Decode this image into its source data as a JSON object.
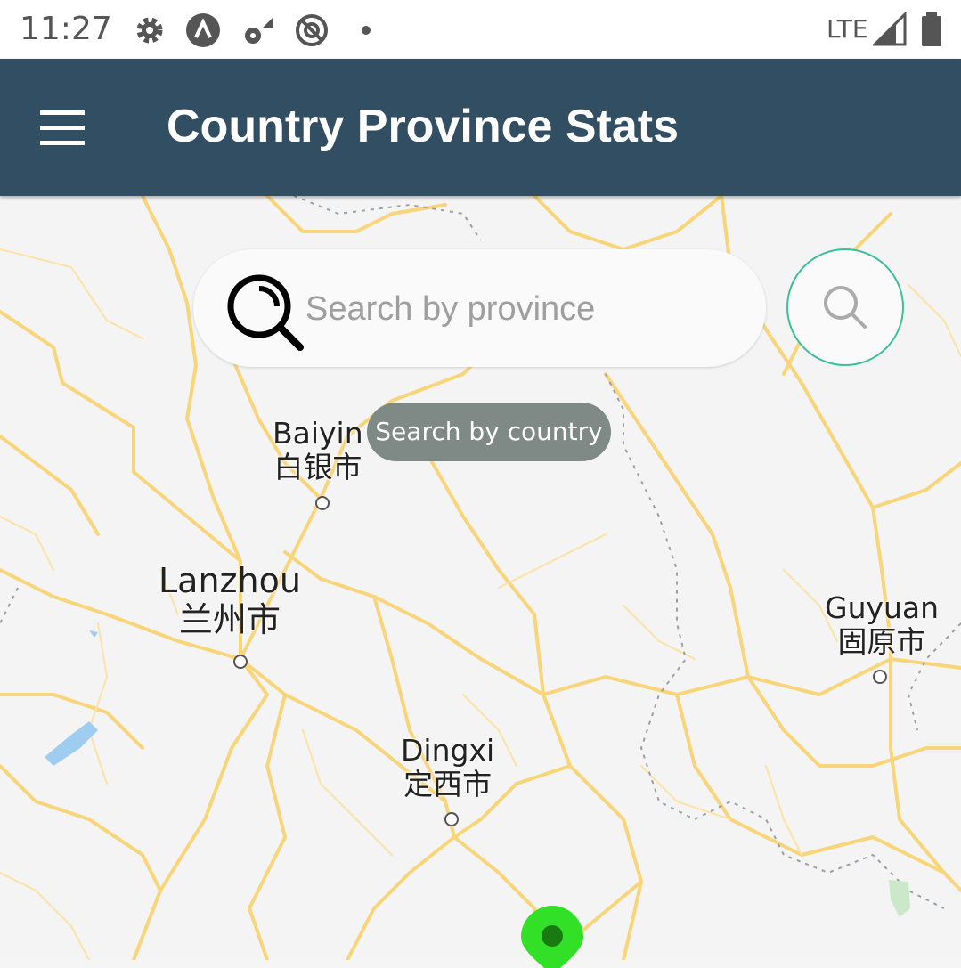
{
  "status_bar": {
    "time": "11:27",
    "network": "LTE",
    "icons": [
      "settings-icon",
      "app-a-icon",
      "signal-off-icon",
      "do-not-disturb-icon",
      "notification-dot-icon",
      "signal-icon",
      "battery-icon"
    ]
  },
  "app_bar": {
    "title": "Country Province Stats",
    "menu_icon": "hamburger-menu-icon"
  },
  "search": {
    "placeholder": "Search by province",
    "value": "",
    "icon": "search-icon",
    "button_icon": "search-icon",
    "tooltip": "Search by country"
  },
  "map": {
    "cities": [
      {
        "en": "Baiyin",
        "zh": "白银市"
      },
      {
        "en": "Lanzhou",
        "zh": "兰州市"
      },
      {
        "en": "Guyuan",
        "zh": "固原市"
      },
      {
        "en": "Dingxi",
        "zh": "定西市"
      }
    ],
    "marker_color": "#33e028",
    "road_color": "#f9d57a"
  },
  "colors": {
    "app_bar": "#314e63",
    "accent": "#3bbf98",
    "tooltip": "#7f8a87"
  }
}
